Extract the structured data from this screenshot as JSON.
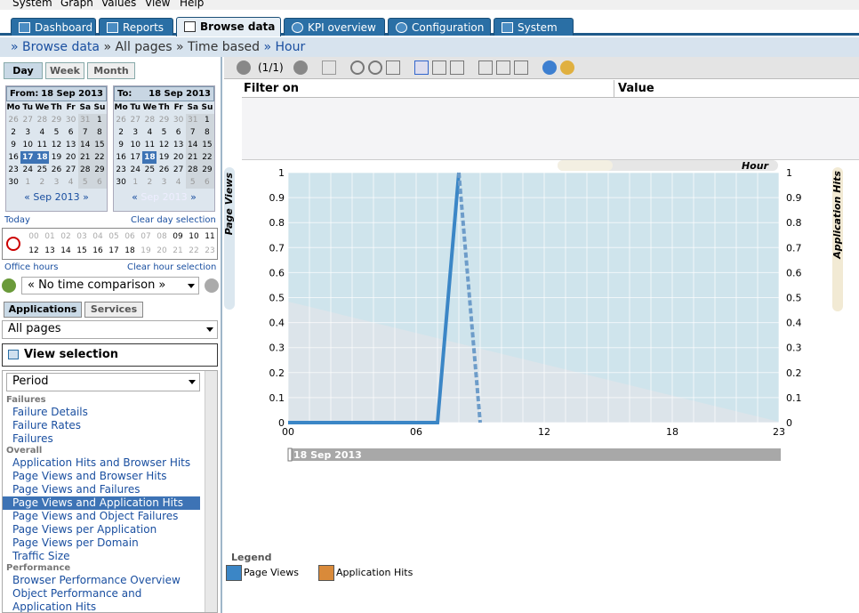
{
  "menu": [
    "System",
    "Graph",
    "Values",
    "View",
    "Help"
  ],
  "tabs": [
    {
      "label": "Dashboard",
      "active": false
    },
    {
      "label": "Reports",
      "active": false
    },
    {
      "label": "Browse data",
      "active": true
    },
    {
      "label": "KPI overview",
      "active": false
    },
    {
      "label": "Configuration",
      "active": false
    },
    {
      "label": "System",
      "active": false
    }
  ],
  "breadcrumb": {
    "browse": "Browse data",
    "pages": "All pages",
    "time": "Time based",
    "hour": "Hour"
  },
  "date_tabs": [
    "Day",
    "Week",
    "Month"
  ],
  "from_label": "From:",
  "from_date": "18 Sep 2013",
  "to_label": "To:",
  "to_date": "18 Sep 2013",
  "weekdays": [
    "Mo",
    "Tu",
    "We",
    "Th",
    "Fr",
    "Sa",
    "Su"
  ],
  "weeks": [
    [
      "26",
      "27",
      "28",
      "29",
      "30",
      "31",
      "1"
    ],
    [
      "2",
      "3",
      "4",
      "5",
      "6",
      "7",
      "8"
    ],
    [
      "9",
      "10",
      "11",
      "12",
      "13",
      "14",
      "15"
    ],
    [
      "16",
      "17",
      "18",
      "19",
      "20",
      "21",
      "22"
    ],
    [
      "23",
      "24",
      "25",
      "26",
      "27",
      "28",
      "29"
    ],
    [
      "30",
      "1",
      "2",
      "3",
      "4",
      "5",
      "6"
    ]
  ],
  "from_nav": "Sep 2013",
  "to_nav": "Sep 2013",
  "today_link": "Today",
  "clear_day": "Clear day selection",
  "hours_row1": [
    "00",
    "01",
    "02",
    "03",
    "04",
    "05",
    "06",
    "07",
    "08",
    "09",
    "10",
    "11"
  ],
  "hours_row2": [
    "12",
    "13",
    "14",
    "15",
    "16",
    "17",
    "18",
    "19",
    "20",
    "21",
    "22",
    "23"
  ],
  "office_hours": "Office hours",
  "clear_hour": "Clear hour selection",
  "time_comparison": "« No time comparison »",
  "app_tabs": [
    "Applications",
    "Services"
  ],
  "pages_select": "All pages",
  "view_selection": "View selection",
  "period_select": "Period",
  "groups": [
    {
      "name": "Failures",
      "items": [
        "Failure Details",
        "Failure Rates",
        "Failures"
      ]
    },
    {
      "name": "Overall",
      "items": [
        "Application Hits and Browser Hits",
        "Page Views and Browser Hits",
        "Page Views and Failures",
        "Page Views and Application Hits",
        "Page Views and Object Failures",
        "Page Views per Application",
        "Page Views per Domain",
        "Traffic Size"
      ]
    },
    {
      "name": "Performance",
      "items": [
        "Browser Performance Overview",
        "Object Performance and",
        "Application Hits"
      ]
    }
  ],
  "highlighted_item": "Page Views and Application Hits",
  "toolbar_page": "(1/1)",
  "filter_on": "Filter on",
  "value": "Value",
  "chart_data": {
    "type": "line",
    "x_ticks": [
      "00",
      "06",
      "12",
      "18",
      "23"
    ],
    "y_ticks": [
      "0",
      "0.1",
      "0.2",
      "0.3",
      "0.4",
      "0.5",
      "0.6",
      "0.7",
      "0.8",
      "0.9",
      "1"
    ],
    "ylim": [
      0,
      1
    ],
    "xlim": [
      0,
      23
    ],
    "ylabel_left": "Page Views",
    "ylabel_right": "Application Hits",
    "resolution_label": "Hour",
    "date_label": "18 Sep 2013",
    "series": [
      {
        "name": "Page Views",
        "color": "#3b86c6",
        "style": "solid",
        "x": [
          0,
          7,
          8
        ],
        "y": [
          0,
          0,
          1
        ]
      },
      {
        "name": "Application Hits",
        "color": "#6d9cc9",
        "style": "dashed",
        "x": [
          8,
          9
        ],
        "y": [
          1,
          0
        ]
      }
    ]
  },
  "legend_title": "Legend",
  "legend": [
    {
      "label": "Page Views",
      "color": "#3b86c6"
    },
    {
      "label": "Application Hits",
      "color": "#d98a3a"
    }
  ]
}
